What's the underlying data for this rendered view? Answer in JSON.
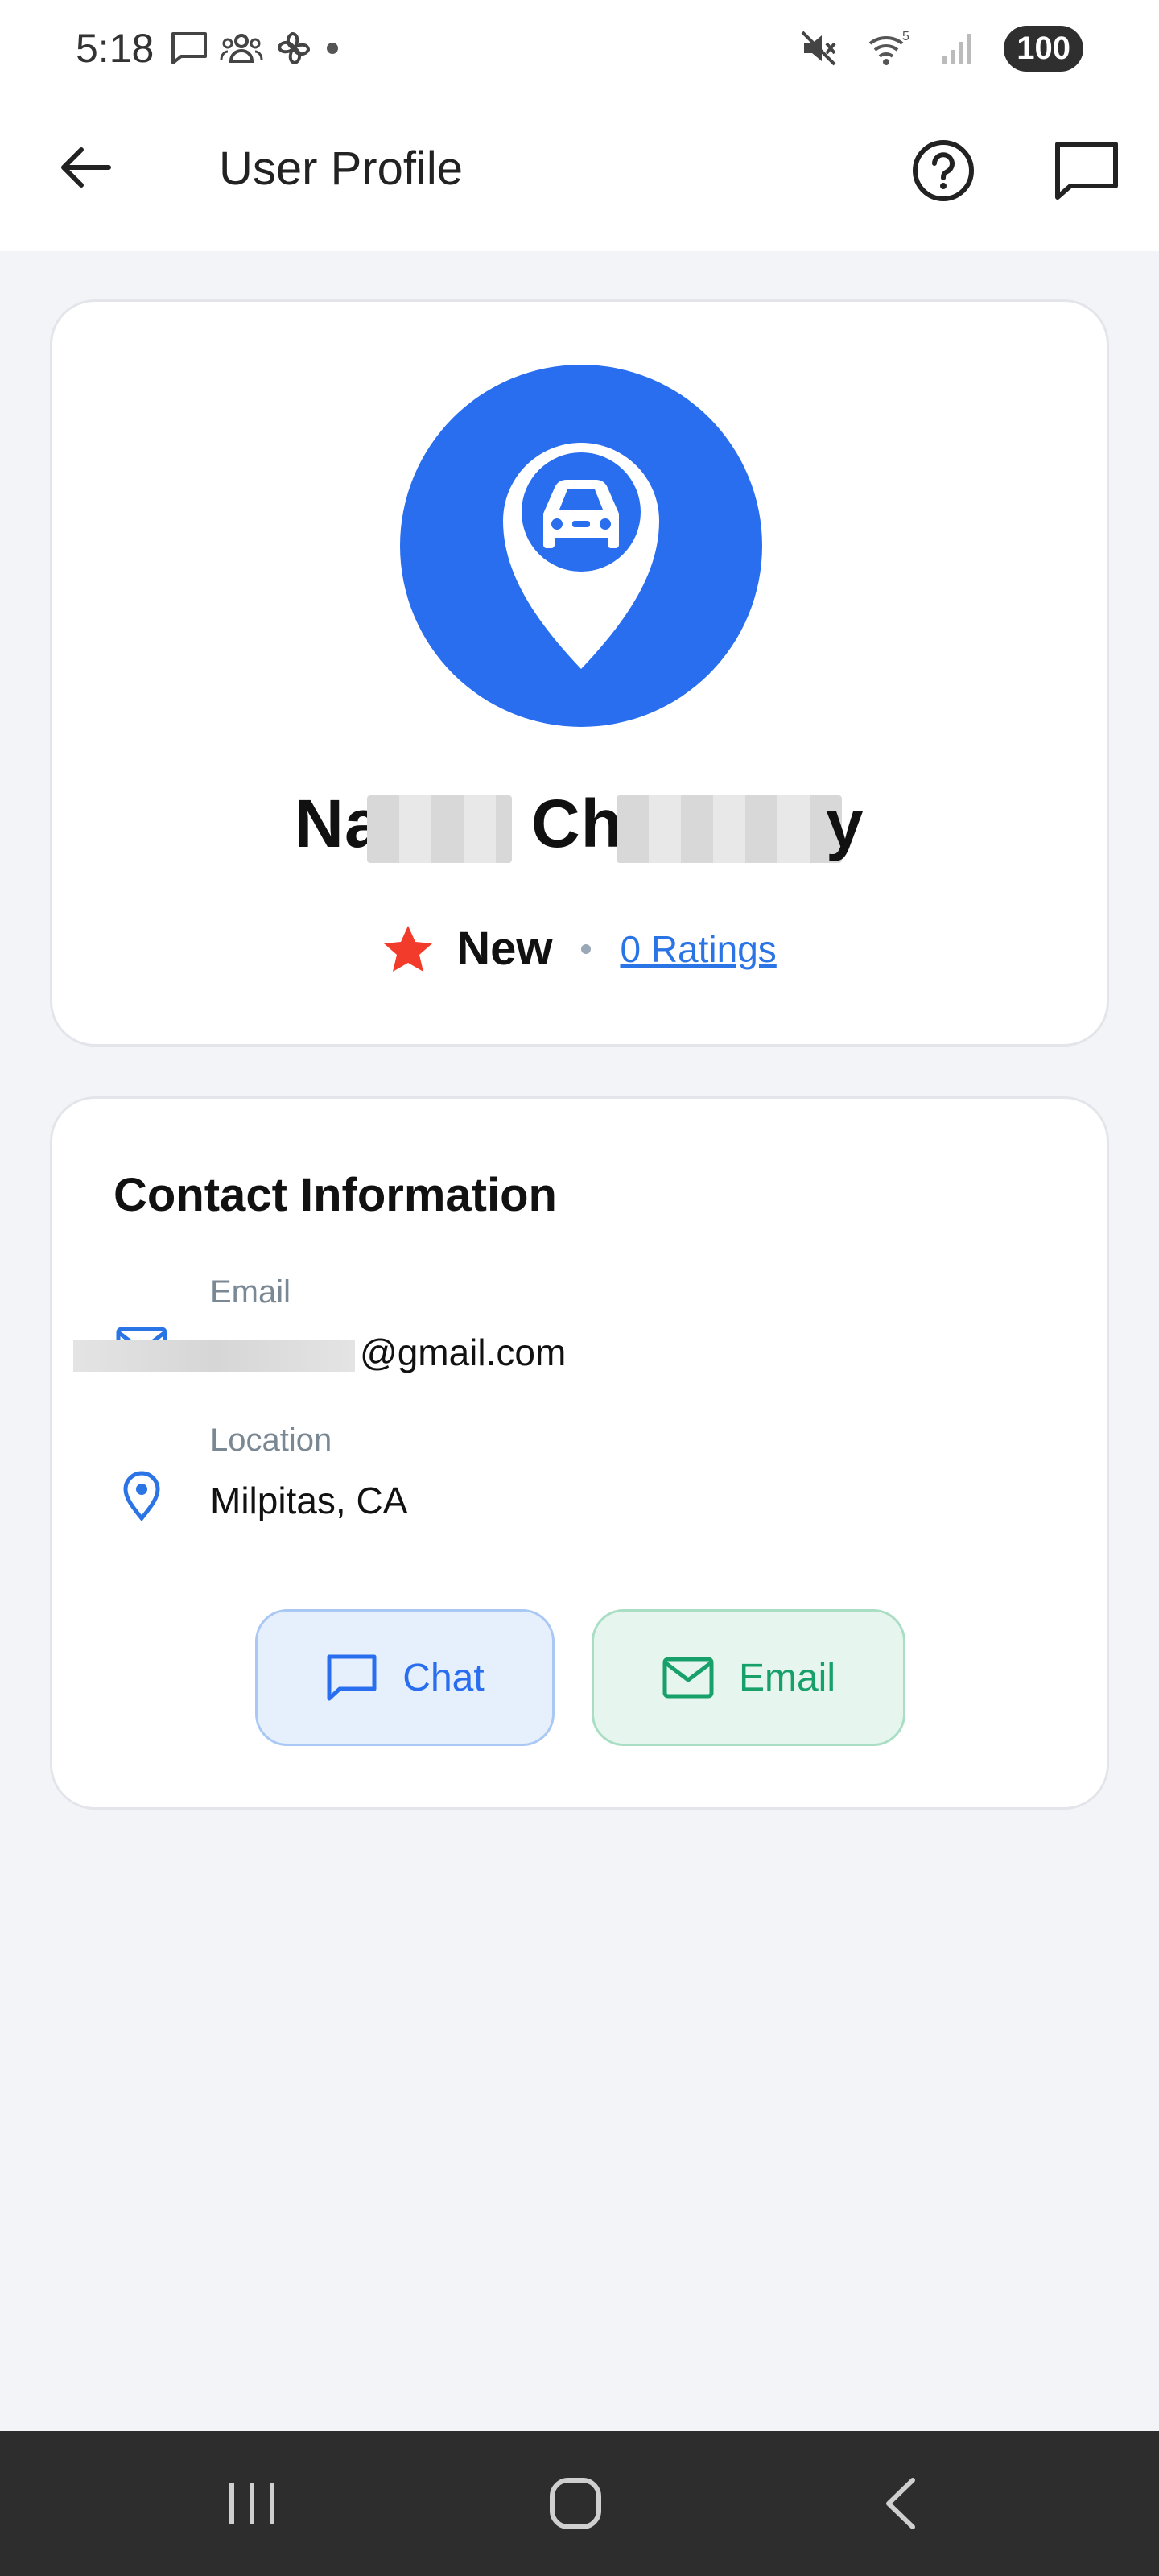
{
  "status_bar": {
    "time": "5:18",
    "battery": "100",
    "wifi_label": "5",
    "icons": [
      "message-icon",
      "group-icon",
      "fan-icon",
      "dot-icon",
      "mute-icon",
      "wifi-icon",
      "signal-icon",
      "battery-icon"
    ]
  },
  "app_bar": {
    "title": "User Profile",
    "icons": [
      "back-arrow-icon",
      "help-icon",
      "chat-bubble-icon"
    ]
  },
  "profile": {
    "name_first_visible": "Na",
    "name_last_visible": "Ch",
    "name_tail_visible": "y",
    "rating_status": "New",
    "ratings_link": "0 Ratings",
    "avatar_icon": "car-location-pin-icon",
    "accent_color": "#2a6ef0",
    "star_color": "#f23b2a"
  },
  "contact": {
    "title": "Contact Information",
    "email_label": "Email",
    "email_value_visible": "@gmail.com",
    "location_label": "Location",
    "location_value": "Milpitas, CA"
  },
  "actions": {
    "chat_label": "Chat",
    "email_label": "Email",
    "chat_color": "#2a6ef0",
    "email_color": "#17a06a"
  },
  "nav_bar": {
    "icons": [
      "recents-icon",
      "home-icon",
      "back-icon"
    ]
  }
}
